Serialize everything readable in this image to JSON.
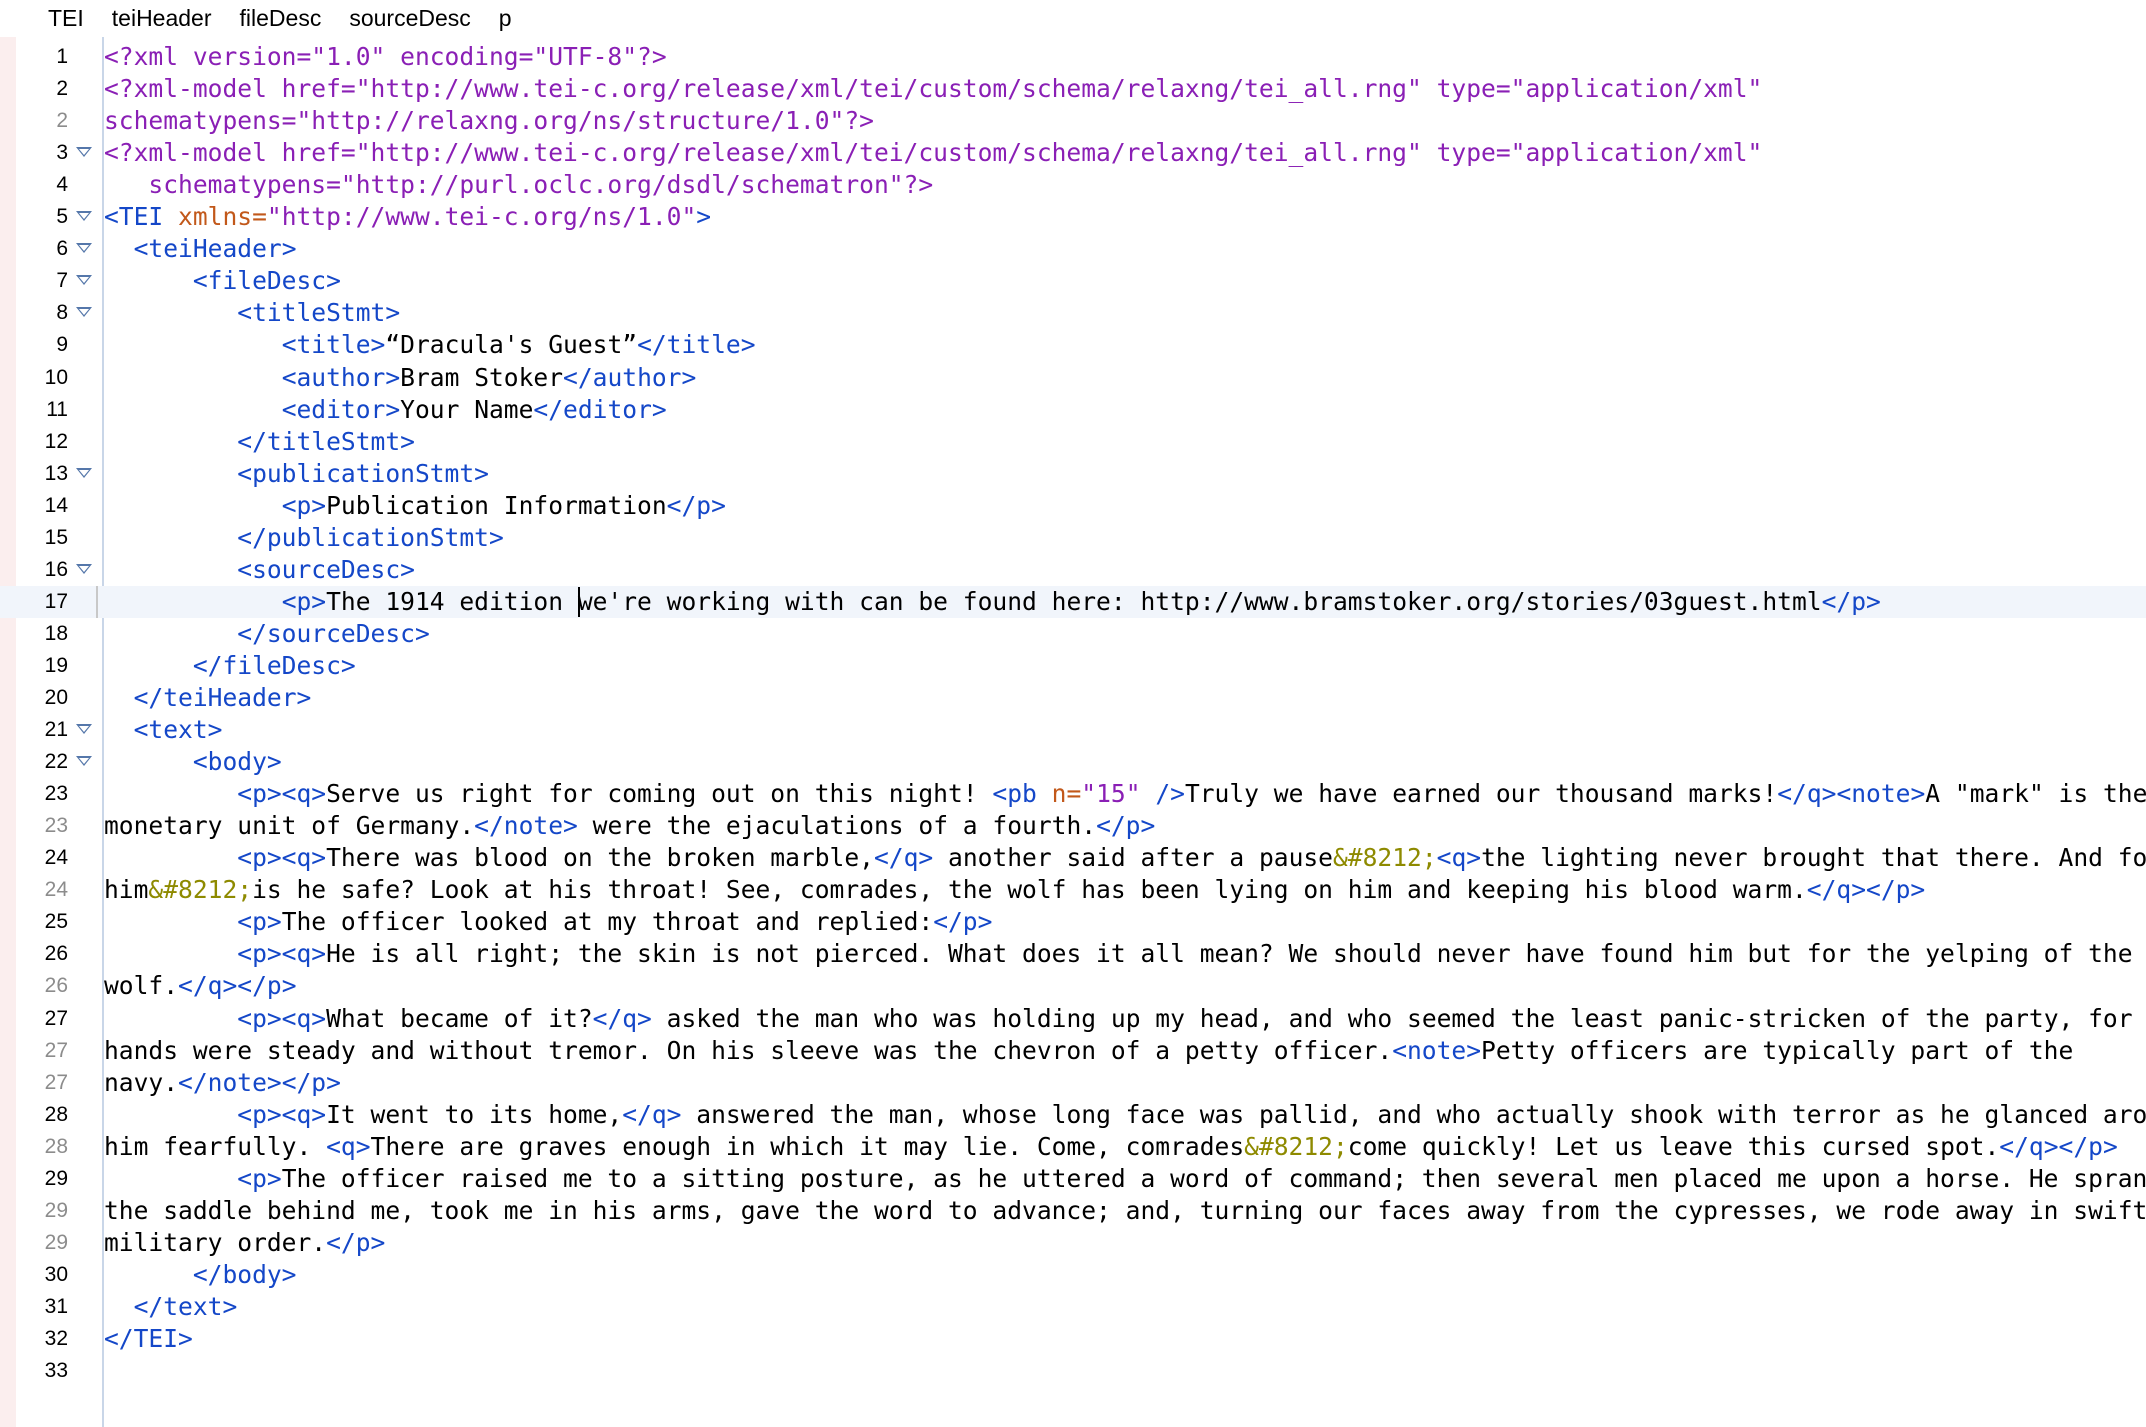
{
  "breadcrumb": [
    "TEI",
    "teiHeader",
    "fileDesc",
    "sourceDesc",
    "p"
  ],
  "editor": {
    "current_line": 17,
    "caret": {
      "line": 17,
      "column": 32
    },
    "colors": {
      "processing_instruction": "#8a1fb5",
      "tag": "#1447c8",
      "attribute_name": "#c2581a",
      "attribute_value": "#8a1fb5",
      "entity": "#8e8a00",
      "text": "#000000",
      "fold_marker": "#5577aa"
    },
    "lines": [
      {
        "num": "1",
        "fold": false,
        "segs": [
          [
            "pi",
            "<?xml version=\"1.0\" encoding=\"UTF-8\"?>"
          ]
        ]
      },
      {
        "num": "2",
        "fold": false,
        "segs": [
          [
            "pi",
            "<?xml-model href=\"http://www.tei-c.org/release/xml/tei/custom/schema/relaxng/tei_all.rng\" type=\"application/xml\""
          ]
        ]
      },
      {
        "num": "2",
        "fold": false,
        "cont": true,
        "segs": [
          [
            "pi",
            "schematypens=\"http://relaxng.org/ns/structure/1.0\"?>"
          ]
        ]
      },
      {
        "num": "3",
        "fold": true,
        "segs": [
          [
            "pi",
            "<?xml-model href=\"http://www.tei-c.org/release/xml/tei/custom/schema/relaxng/tei_all.rng\" type=\"application/xml\""
          ]
        ]
      },
      {
        "num": "4",
        "fold": false,
        "segs": [
          [
            "pi",
            "   schematypens=\"http://purl.oclc.org/dsdl/schematron\"?>"
          ]
        ]
      },
      {
        "num": "5",
        "fold": true,
        "segs": [
          [
            "tag",
            "<TEI "
          ],
          [
            "attr",
            "xmlns="
          ],
          [
            "val",
            "\"http://www.tei-c.org/ns/1.0\""
          ],
          [
            "tag",
            ">"
          ]
        ]
      },
      {
        "num": "6",
        "fold": true,
        "segs": [
          [
            "text",
            "  "
          ],
          [
            "tag",
            "<teiHeader>"
          ]
        ]
      },
      {
        "num": "7",
        "fold": true,
        "segs": [
          [
            "text",
            "      "
          ],
          [
            "tag",
            "<fileDesc>"
          ]
        ]
      },
      {
        "num": "8",
        "fold": true,
        "segs": [
          [
            "text",
            "         "
          ],
          [
            "tag",
            "<titleStmt>"
          ]
        ]
      },
      {
        "num": "9",
        "fold": false,
        "segs": [
          [
            "text",
            "            "
          ],
          [
            "tag",
            "<title>"
          ],
          [
            "text",
            "“Dracula's Guest”"
          ],
          [
            "tag",
            "</title>"
          ]
        ]
      },
      {
        "num": "10",
        "fold": false,
        "segs": [
          [
            "text",
            "            "
          ],
          [
            "tag",
            "<author>"
          ],
          [
            "text",
            "Bram Stoker"
          ],
          [
            "tag",
            "</author>"
          ]
        ]
      },
      {
        "num": "11",
        "fold": false,
        "segs": [
          [
            "text",
            "            "
          ],
          [
            "tag",
            "<editor>"
          ],
          [
            "text",
            "Your Name"
          ],
          [
            "tag",
            "</editor>"
          ]
        ]
      },
      {
        "num": "12",
        "fold": false,
        "segs": [
          [
            "text",
            "         "
          ],
          [
            "tag",
            "</titleStmt>"
          ]
        ]
      },
      {
        "num": "13",
        "fold": true,
        "segs": [
          [
            "text",
            "         "
          ],
          [
            "tag",
            "<publicationStmt>"
          ]
        ]
      },
      {
        "num": "14",
        "fold": false,
        "segs": [
          [
            "text",
            "            "
          ],
          [
            "tag",
            "<p>"
          ],
          [
            "text",
            "Publication Information"
          ],
          [
            "tag",
            "</p>"
          ]
        ]
      },
      {
        "num": "15",
        "fold": false,
        "segs": [
          [
            "text",
            "         "
          ],
          [
            "tag",
            "</publicationStmt>"
          ]
        ]
      },
      {
        "num": "16",
        "fold": true,
        "segs": [
          [
            "text",
            "         "
          ],
          [
            "tag",
            "<sourceDesc>"
          ]
        ]
      },
      {
        "num": "17",
        "fold": false,
        "current": true,
        "segs": [
          [
            "text",
            "            "
          ],
          [
            "tag",
            "<p>"
          ],
          [
            "text",
            "The 1914 edition we're working with can be found here: http://www.bramstoker.org/stories/03guest.html"
          ],
          [
            "tag",
            "</p>"
          ]
        ]
      },
      {
        "num": "18",
        "fold": false,
        "segs": [
          [
            "text",
            "         "
          ],
          [
            "tag",
            "</sourceDesc>"
          ]
        ]
      },
      {
        "num": "19",
        "fold": false,
        "segs": [
          [
            "text",
            "      "
          ],
          [
            "tag",
            "</fileDesc>"
          ]
        ]
      },
      {
        "num": "20",
        "fold": false,
        "segs": [
          [
            "text",
            "  "
          ],
          [
            "tag",
            "</teiHeader>"
          ]
        ]
      },
      {
        "num": "21",
        "fold": true,
        "segs": [
          [
            "text",
            "  "
          ],
          [
            "tag",
            "<text>"
          ]
        ]
      },
      {
        "num": "22",
        "fold": true,
        "segs": [
          [
            "text",
            "      "
          ],
          [
            "tag",
            "<body>"
          ]
        ]
      },
      {
        "num": "23",
        "fold": false,
        "segs": [
          [
            "text",
            "         "
          ],
          [
            "tag",
            "<p><q>"
          ],
          [
            "text",
            "Serve us right for coming out on this night! "
          ],
          [
            "tag",
            "<pb "
          ],
          [
            "attr",
            "n="
          ],
          [
            "val",
            "\"15\""
          ],
          [
            "tag",
            " />"
          ],
          [
            "text",
            "Truly we have earned our thousand marks!"
          ],
          [
            "tag",
            "</q><note>"
          ],
          [
            "text",
            "A \"mark\" is the basic"
          ]
        ]
      },
      {
        "num": "23",
        "fold": false,
        "cont": true,
        "segs": [
          [
            "text",
            "monetary unit of Germany."
          ],
          [
            "tag",
            "</note>"
          ],
          [
            "text",
            " were the ejaculations of a fourth."
          ],
          [
            "tag",
            "</p>"
          ]
        ]
      },
      {
        "num": "24",
        "fold": false,
        "segs": [
          [
            "text",
            "         "
          ],
          [
            "tag",
            "<p><q>"
          ],
          [
            "text",
            "There was blood on the broken marble,"
          ],
          [
            "tag",
            "</q>"
          ],
          [
            "text",
            " another said after a pause"
          ],
          [
            "ent",
            "&#8212;"
          ],
          [
            "tag",
            "<q>"
          ],
          [
            "text",
            "the lighting never brought that there. And for"
          ]
        ]
      },
      {
        "num": "24",
        "fold": false,
        "cont": true,
        "segs": [
          [
            "text",
            "him"
          ],
          [
            "ent",
            "&#8212;"
          ],
          [
            "text",
            "is he safe? Look at his throat! See, comrades, the wolf has been lying on him and keeping his blood warm."
          ],
          [
            "tag",
            "</q></p>"
          ]
        ]
      },
      {
        "num": "25",
        "fold": false,
        "segs": [
          [
            "text",
            "         "
          ],
          [
            "tag",
            "<p>"
          ],
          [
            "text",
            "The officer looked at my throat and replied:"
          ],
          [
            "tag",
            "</p>"
          ]
        ]
      },
      {
        "num": "26",
        "fold": false,
        "segs": [
          [
            "text",
            "         "
          ],
          [
            "tag",
            "<p><q>"
          ],
          [
            "text",
            "He is all right; the skin is not pierced. What does it all mean? We should never have found him but for the yelping of the"
          ]
        ]
      },
      {
        "num": "26",
        "fold": false,
        "cont": true,
        "segs": [
          [
            "text",
            "wolf."
          ],
          [
            "tag",
            "</q></p>"
          ]
        ]
      },
      {
        "num": "27",
        "fold": false,
        "segs": [
          [
            "text",
            "         "
          ],
          [
            "tag",
            "<p><q>"
          ],
          [
            "text",
            "What became of it?"
          ],
          [
            "tag",
            "</q>"
          ],
          [
            "text",
            " asked the man who was holding up my head, and who seemed the least panic-stricken of the party, for his"
          ]
        ]
      },
      {
        "num": "27",
        "fold": false,
        "cont": true,
        "segs": [
          [
            "text",
            "hands were steady and without tremor. On his sleeve was the chevron of a petty officer."
          ],
          [
            "tag",
            "<note>"
          ],
          [
            "text",
            "Petty officers are typically part of the"
          ]
        ]
      },
      {
        "num": "27",
        "fold": false,
        "cont": true,
        "segs": [
          [
            "text",
            "navy."
          ],
          [
            "tag",
            "</note></p>"
          ]
        ]
      },
      {
        "num": "28",
        "fold": false,
        "segs": [
          [
            "text",
            "         "
          ],
          [
            "tag",
            "<p><q>"
          ],
          [
            "text",
            "It went to its home,"
          ],
          [
            "tag",
            "</q>"
          ],
          [
            "text",
            " answered the man, whose long face was pallid, and who actually shook with terror as he glanced around"
          ]
        ]
      },
      {
        "num": "28",
        "fold": false,
        "cont": true,
        "segs": [
          [
            "text",
            "him fearfully. "
          ],
          [
            "tag",
            "<q>"
          ],
          [
            "text",
            "There are graves enough in which it may lie. Come, comrades"
          ],
          [
            "ent",
            "&#8212;"
          ],
          [
            "text",
            "come quickly! Let us leave this cursed spot."
          ],
          [
            "tag",
            "</q></p>"
          ]
        ]
      },
      {
        "num": "29",
        "fold": false,
        "segs": [
          [
            "text",
            "         "
          ],
          [
            "tag",
            "<p>"
          ],
          [
            "text",
            "The officer raised me to a sitting posture, as he uttered a word of command; then several men placed me upon a horse. He sprang to"
          ]
        ]
      },
      {
        "num": "29",
        "fold": false,
        "cont": true,
        "segs": [
          [
            "text",
            "the saddle behind me, took me in his arms, gave the word to advance; and, turning our faces away from the cypresses, we rode away in swift,"
          ]
        ]
      },
      {
        "num": "29",
        "fold": false,
        "cont": true,
        "segs": [
          [
            "text",
            "military order."
          ],
          [
            "tag",
            "</p>"
          ]
        ]
      },
      {
        "num": "30",
        "fold": false,
        "segs": [
          [
            "text",
            "      "
          ],
          [
            "tag",
            "</body>"
          ]
        ]
      },
      {
        "num": "31",
        "fold": false,
        "segs": [
          [
            "text",
            "  "
          ],
          [
            "tag",
            "</text>"
          ]
        ]
      },
      {
        "num": "32",
        "fold": false,
        "segs": [
          [
            "tag",
            "</TEI>"
          ]
        ]
      },
      {
        "num": "33",
        "fold": false,
        "segs": []
      }
    ]
  }
}
